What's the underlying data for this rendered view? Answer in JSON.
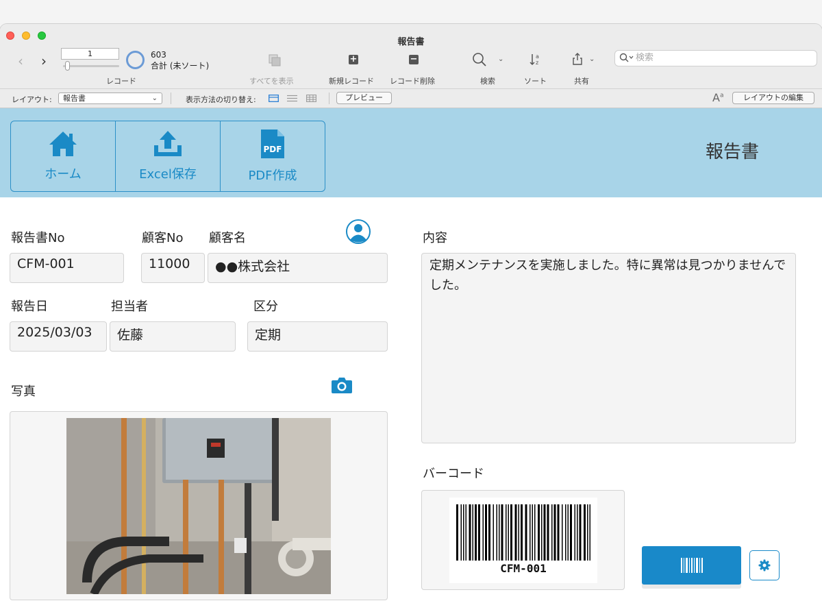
{
  "window": {
    "title": "報告書"
  },
  "toolbar": {
    "record_number": "1",
    "record_total": "603",
    "record_status": "合計 (未ソート)",
    "record_label": "レコード",
    "show_all_label": "すべてを表示",
    "new_record_label": "新規レコード",
    "delete_record_label": "レコード削除",
    "find_label": "検索",
    "sort_label": "ソート",
    "share_label": "共有",
    "search_placeholder": "検索"
  },
  "layout_bar": {
    "layout_label": "レイアウト:",
    "layout_value": "報告書",
    "view_switch_label": "表示方法の切り替え:",
    "preview_button": "プレビュー",
    "edit_layout_button": "レイアウトの編集"
  },
  "header": {
    "buttons": [
      {
        "label": "ホーム",
        "icon": "home-icon"
      },
      {
        "label": "Excel保存",
        "icon": "upload-icon"
      },
      {
        "label": "PDF作成",
        "icon": "pdf-icon",
        "badge": "PDF"
      }
    ],
    "page_title": "報告書",
    "band_color": "#a8d4e8",
    "accent_color": "#1a8ac6"
  },
  "form": {
    "report_no": {
      "label": "報告書No",
      "value": "CFM-001"
    },
    "customer_no": {
      "label": "顧客No",
      "value": "11000"
    },
    "customer_name": {
      "label": "顧客名",
      "value": "●●株式会社"
    },
    "report_date": {
      "label": "報告日",
      "value": "2025/03/03"
    },
    "staff": {
      "label": "担当者",
      "value": "佐藤"
    },
    "category": {
      "label": "区分",
      "value": "定期"
    },
    "photo": {
      "label": "写真"
    },
    "content": {
      "label": "内容",
      "value": "定期メンテナンスを実施しました。特に異常は見つかりませんでした。"
    },
    "barcode": {
      "label": "バーコード",
      "text": "CFM-001"
    }
  }
}
